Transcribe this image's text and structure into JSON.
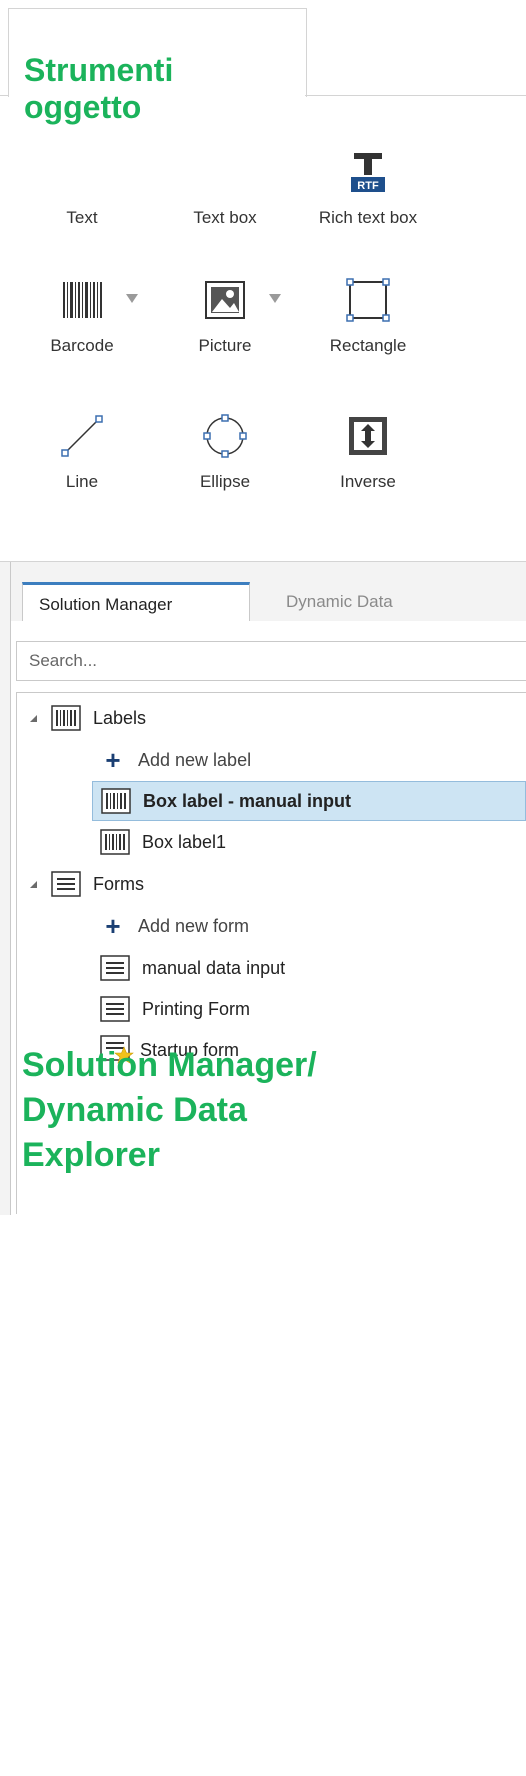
{
  "toolbox": {
    "title": "Strumenti\noggetto",
    "tools": [
      {
        "label": "Text",
        "icon": "text-tool-icon"
      },
      {
        "label": "Text box",
        "icon": "text-box-icon"
      },
      {
        "label": "Rich text box",
        "icon": "rich-text-box-icon",
        "badge": "RTF"
      },
      {
        "label": "Barcode",
        "icon": "barcode-icon"
      },
      {
        "label": "Picture",
        "icon": "picture-icon"
      },
      {
        "label": "Rectangle",
        "icon": "rectangle-icon"
      },
      {
        "label": "Line",
        "icon": "line-icon"
      },
      {
        "label": "Ellipse",
        "icon": "ellipse-icon"
      },
      {
        "label": "Inverse",
        "icon": "inverse-icon"
      }
    ]
  },
  "solution_manager": {
    "tabs": [
      {
        "label": "Solution Manager",
        "active": true
      },
      {
        "label": "Dynamic Data",
        "active": false
      }
    ],
    "search_placeholder": "Search...",
    "tree": {
      "labels_group": "Labels",
      "add_label": "Add new label",
      "label_items": [
        "Box label - manual input",
        "Box label1"
      ],
      "forms_group": "Forms",
      "add_form": "Add new form",
      "form_items": [
        "manual data input",
        "Printing Form",
        "Startup form"
      ]
    },
    "overlay_title": "Solution Manager/\nDynamic Data\nExplorer"
  },
  "colors": {
    "accent_green": "#1bb35b",
    "selection_bg": "#cde4f3",
    "tab_accent": "#3c7ebf",
    "plus_blue": "#1a3f73"
  }
}
